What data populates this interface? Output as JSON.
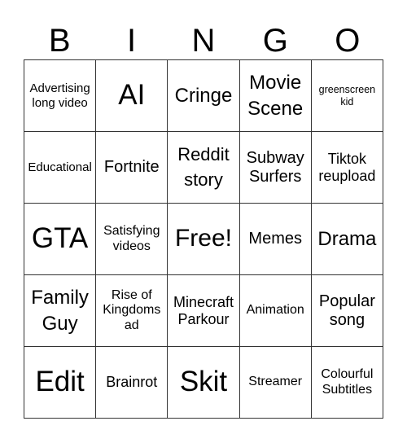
{
  "header": [
    "B",
    "I",
    "N",
    "G",
    "O"
  ],
  "cells": [
    "Advertising long video",
    "AI",
    "Cringe",
    "Movie Scene",
    "greenscreen kid",
    "Educational",
    "Fortnite",
    "Reddit story",
    "Subway Surfers",
    "Tiktok reupload",
    "GTA",
    "Satisfying videos",
    "Free!",
    "Memes",
    "Drama",
    "Family Guy",
    "Rise of Kingdoms ad",
    "Minecraft Parkour",
    "Animation",
    "Popular song",
    "Edit",
    "Brainrot",
    "Skit",
    "Streamer",
    "Colourful Subtitles"
  ]
}
